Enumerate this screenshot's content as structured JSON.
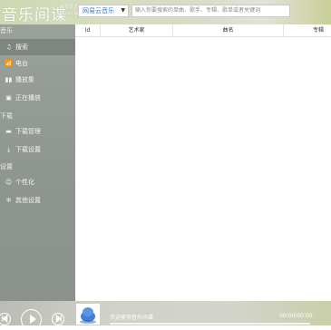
{
  "app": {
    "logo_text": "音乐间谍",
    "logo_sub_line1": "免费录音版",
    "logo_sub_line2": "Music Spy"
  },
  "search": {
    "source": "网易云音乐",
    "placeholder": "输入你要搜索的单曲、歌手、专辑、歌单或者关键词"
  },
  "sidebar": {
    "sections": [
      {
        "label": "音乐",
        "items": [
          {
            "label": "搜索",
            "icon": "music-note-icon"
          },
          {
            "label": "电台",
            "icon": "radio-icon"
          },
          {
            "label": "播放集",
            "icon": "bars-icon"
          },
          {
            "label": "正在播放",
            "icon": "play-box-icon"
          }
        ]
      },
      {
        "label": "下载",
        "items": [
          {
            "label": "下载管理",
            "icon": "folder-icon"
          },
          {
            "label": "下载设置",
            "icon": "download-icon"
          }
        ]
      },
      {
        "label": "设置",
        "items": [
          {
            "label": "个性化",
            "icon": "user-icon"
          },
          {
            "label": "其他设置",
            "icon": "gear-icon"
          }
        ]
      }
    ]
  },
  "table": {
    "columns": [
      "Id",
      "艺术家",
      "曲名",
      "专辑"
    ]
  },
  "player": {
    "status_text": "欢迎使用音乐间谍",
    "time": "00:00/00:00",
    "progress": 0
  }
}
